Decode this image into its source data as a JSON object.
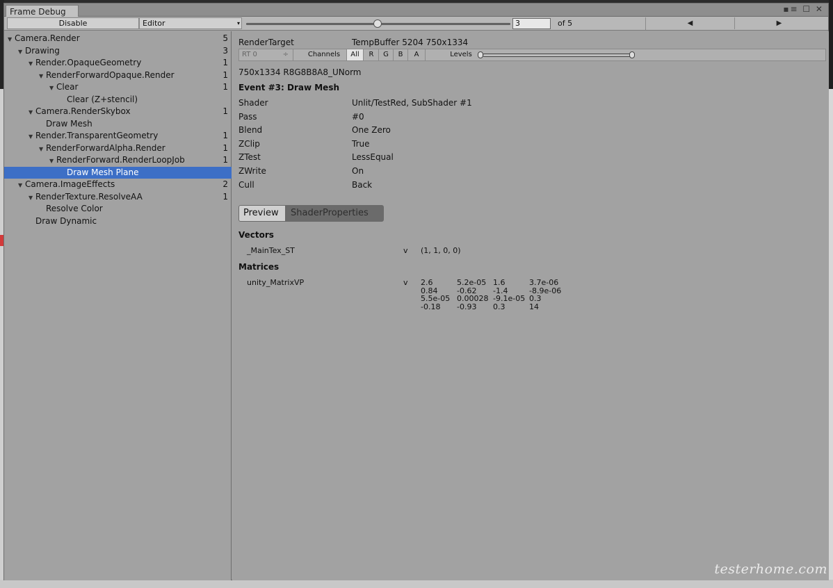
{
  "window": {
    "title": "Frame Debug",
    "controls": "▪≡ ☐ ✕"
  },
  "toolbar": {
    "disable_label": "Disable",
    "target_label": "Editor",
    "target_arrow": "▾",
    "frame_value": "3",
    "of_label": "of 5",
    "prev_icon": "◀",
    "next_icon": "▶",
    "slider_fraction": 0.5
  },
  "tree": [
    {
      "label": "Camera.Render",
      "count": "5",
      "depth": 0,
      "expanded": true
    },
    {
      "label": "Drawing",
      "count": "3",
      "depth": 1,
      "expanded": true
    },
    {
      "label": "Render.OpaqueGeometry",
      "count": "1",
      "depth": 2,
      "expanded": true
    },
    {
      "label": "RenderForwardOpaque.Render",
      "count": "1",
      "depth": 3,
      "expanded": true
    },
    {
      "label": "Clear",
      "count": "1",
      "depth": 4,
      "expanded": true
    },
    {
      "label": "Clear (Z+stencil)",
      "count": "",
      "depth": 5,
      "expanded": false
    },
    {
      "label": "Camera.RenderSkybox",
      "count": "1",
      "depth": 2,
      "expanded": true
    },
    {
      "label": "Draw Mesh",
      "count": "",
      "depth": 3,
      "expanded": false
    },
    {
      "label": "Render.TransparentGeometry",
      "count": "1",
      "depth": 2,
      "expanded": true
    },
    {
      "label": "RenderForwardAlpha.Render",
      "count": "1",
      "depth": 3,
      "expanded": true
    },
    {
      "label": "RenderForward.RenderLoopJob",
      "count": "1",
      "depth": 4,
      "expanded": true
    },
    {
      "label": "Draw Mesh Plane",
      "count": "",
      "depth": 5,
      "expanded": false,
      "selected": true
    },
    {
      "label": "Camera.ImageEffects",
      "count": "2",
      "depth": 1,
      "expanded": true
    },
    {
      "label": "RenderTexture.ResolveAA",
      "count": "1",
      "depth": 2,
      "expanded": true
    },
    {
      "label": "Resolve Color",
      "count": "",
      "depth": 3,
      "expanded": false
    },
    {
      "label": "Draw Dynamic",
      "count": "",
      "depth": 2,
      "expanded": false
    }
  ],
  "details": {
    "render_target_label": "RenderTarget",
    "render_target_value": "TempBuffer 5204 750x1334",
    "rt_select": "RT 0",
    "rt_arrow": "÷",
    "channels_label": "Channels",
    "channels": [
      "All",
      "R",
      "G",
      "B",
      "A"
    ],
    "channel_selected": "All",
    "levels_label": "Levels",
    "format": "750x1334 R8G8B8A8_UNorm",
    "event_title": "Event #3: Draw Mesh",
    "props": [
      {
        "key": "Shader",
        "value": "Unlit/TestRed, SubShader #1"
      },
      {
        "key": "Pass",
        "value": "#0"
      },
      {
        "key": "Blend",
        "value": "One Zero"
      },
      {
        "key": "ZClip",
        "value": "True"
      },
      {
        "key": "ZTest",
        "value": "LessEqual"
      },
      {
        "key": "ZWrite",
        "value": "On"
      },
      {
        "key": "Cull",
        "value": "Back"
      }
    ],
    "tabs": [
      "Preview",
      "ShaderProperties"
    ],
    "active_tab": "ShaderProperties",
    "vectors_heading": "Vectors",
    "vectors": [
      {
        "name": "_MainTex_ST",
        "stage": "v",
        "value": "(1, 1, 0, 0)"
      }
    ],
    "matrices_heading": "Matrices",
    "matrices": [
      {
        "name": "unity_MatrixVP",
        "stage": "v",
        "rows": [
          [
            "2.6",
            "5.2e-05",
            "1.6",
            "3.7e-06"
          ],
          [
            "0.84",
            "-0.62",
            "-1.4",
            "-8.9e-06"
          ],
          [
            "5.5e-05",
            "0.00028",
            "-9.1e-05",
            "0.3"
          ],
          [
            "-0.18",
            "-0.93",
            "0.3",
            "14"
          ]
        ]
      }
    ]
  },
  "watermark": "testerhome.com"
}
